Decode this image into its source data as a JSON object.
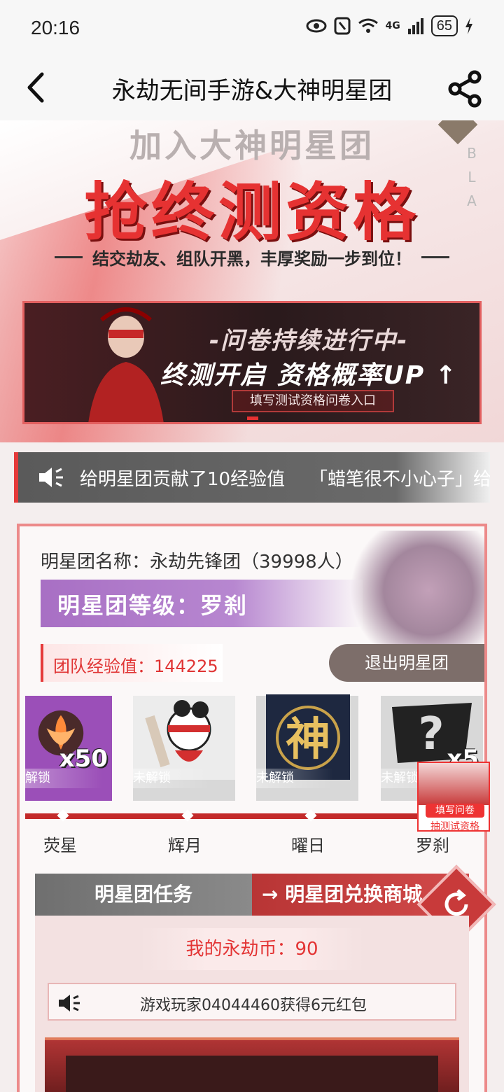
{
  "status": {
    "time": "20:16",
    "battery": "65",
    "network": "4G"
  },
  "nav": {
    "title": "永劫无间手游&大神明星团"
  },
  "hero": {
    "subtitle": "加入大神明星团",
    "title": "抢终测资格",
    "slogan": "结交劫友、组队开黑，丰厚奖励一步到位！",
    "side_text": "B L A"
  },
  "banner": {
    "line1": "-问卷持续进行中-",
    "line2": "终测开启 资格概率UP ↑",
    "button": "填写测试资格问卷入口"
  },
  "ticker": {
    "message1": "给明星团贡献了10经验值",
    "message2": "「蜡笔很不小心子」给"
  },
  "team": {
    "name_label": "明星团名称：永劫先锋团（39998人）",
    "level_label": "明星团等级：罗刹",
    "xp_label": "团队经验值：144225",
    "exit_button": "退出明星团"
  },
  "rewards": [
    {
      "label": "解锁",
      "count": "x50"
    },
    {
      "label": "未解锁",
      "count": ""
    },
    {
      "label": "未解锁",
      "count": ""
    },
    {
      "label": "未解锁",
      "count": "x5"
    }
  ],
  "tiers": [
    "荧星",
    "辉月",
    "曜日",
    "罗刹"
  ],
  "float_card": {
    "tag": "填写问卷",
    "caption": "抽测试资格"
  },
  "tabs": {
    "tasks": "明星团任务",
    "shop": "→ 明星团兑换商城"
  },
  "shop": {
    "coins_label": "我的永劫币：90",
    "notice": "游戏玩家04044460获得6元红包"
  },
  "colors": {
    "accent": "#e33434",
    "level_purple": "#a86fc4",
    "dark_gray": "#6f6f6f"
  }
}
